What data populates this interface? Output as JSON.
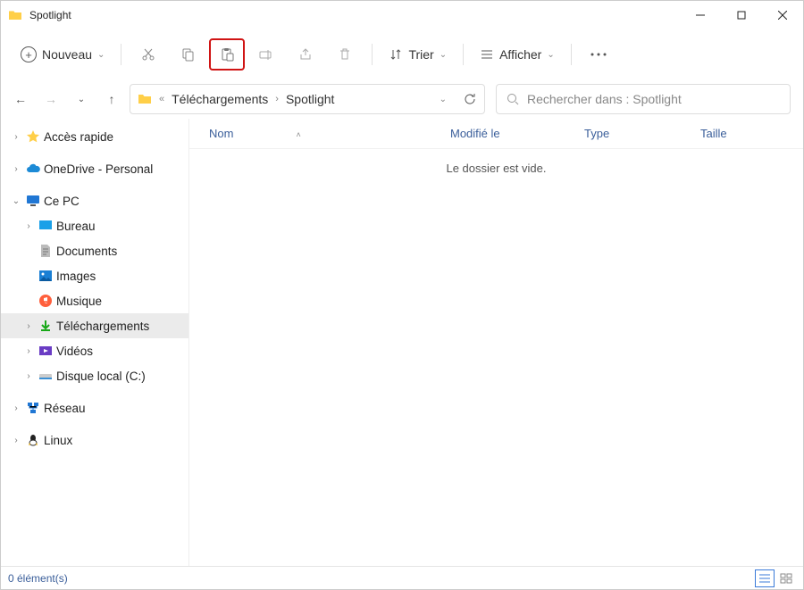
{
  "titlebar": {
    "title": "Spotlight"
  },
  "toolbar": {
    "new_label": "Nouveau",
    "sort_label": "Trier",
    "view_label": "Afficher"
  },
  "breadcrumb": {
    "parent": "Téléchargements",
    "current": "Spotlight"
  },
  "search": {
    "placeholder": "Rechercher dans : Spotlight"
  },
  "columns": {
    "name": "Nom",
    "modified": "Modifié le",
    "type": "Type",
    "size": "Taille"
  },
  "list": {
    "empty_message": "Le dossier est vide."
  },
  "tree": {
    "quick_access": "Accès rapide",
    "onedrive": "OneDrive - Personal",
    "this_pc": "Ce PC",
    "desktop": "Bureau",
    "documents": "Documents",
    "pictures": "Images",
    "music": "Musique",
    "downloads": "Téléchargements",
    "videos": "Vidéos",
    "local_disk": "Disque local (C:)",
    "network": "Réseau",
    "linux": "Linux"
  },
  "status": {
    "count_label": "0 élément(s)"
  }
}
